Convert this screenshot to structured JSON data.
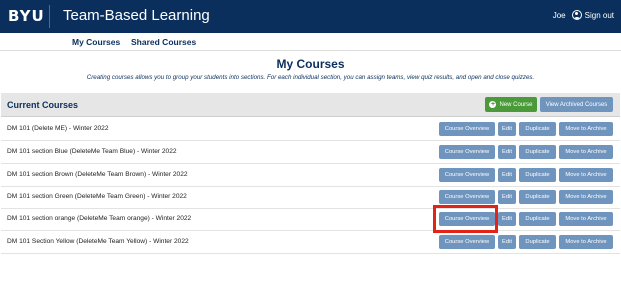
{
  "header": {
    "logo": "BYU",
    "app_title": "Team-Based Learning",
    "user_name": "Joe",
    "sign_out": "Sign out"
  },
  "nav": {
    "my_courses": "My Courses",
    "shared_courses": "Shared Courses"
  },
  "page": {
    "title": "My Courses",
    "description": "Creating courses allows you to group your students into sections. For each individual section, you can assign teams, view quiz results, and open and close quizzes."
  },
  "panel": {
    "title": "Current Courses",
    "new_course": "New Course",
    "view_archived": "View Archived Courses"
  },
  "row_buttons": {
    "overview": "Course Overview",
    "edit": "Edit",
    "duplicate": "Duplicate",
    "archive": "Move to Archive"
  },
  "courses": [
    "DM 101 (Delete ME) - Winter 2022",
    "DM 101 section Blue (DeleteMe Team Blue) - Winter 2022",
    "DM 101 section Brown (DeleteMe Team Brown) - Winter 2022",
    "DM 101 section Green (DeleteMe Team Green) - Winter 2022",
    "DM 101 section orange (DeleteMe Team orange) - Winter 2022",
    "DM 101 Section Yellow (DeleteMe Team Yellow) - Winter 2022"
  ],
  "highlighted_course": "DM 101 section orange (DeleteMe Team orange) - Winter 2022",
  "colors": {
    "header_bg": "#0a2f5c",
    "button": "#6f94bd",
    "new_button": "#4a9a3a",
    "highlight": "#e2231a"
  },
  "icons": {
    "user": "user-circle-icon",
    "new": "plus-circle-icon"
  }
}
